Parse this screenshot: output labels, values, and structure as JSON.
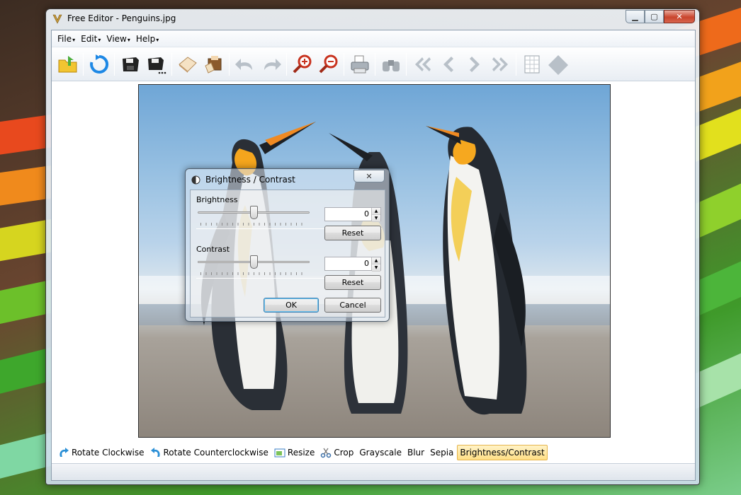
{
  "window": {
    "title": "Free Editor - Penguins.jpg",
    "minimize": "▁",
    "maximize": "▢",
    "close": "✕"
  },
  "menu": [
    {
      "label": "File",
      "arrow": "▾"
    },
    {
      "label": "Edit",
      "arrow": "▾"
    },
    {
      "label": "View",
      "arrow": "▾"
    },
    {
      "label": "Help",
      "arrow": "▾"
    }
  ],
  "toolbar": {
    "icons": [
      "open-folder-icon",
      "refresh-icon",
      "save-icon",
      "save-as-icon",
      "open-image-icon",
      "edit-image-icon",
      "undo-icon",
      "redo-icon",
      "zoom-in-icon",
      "zoom-out-icon",
      "print-icon",
      "binoculars-icon",
      "first-icon",
      "previous-icon",
      "next-icon",
      "last-icon",
      "grid-icon",
      "diamond-icon"
    ]
  },
  "dialog": {
    "title": "Brightness / Contrast",
    "close": "✕",
    "brightness": {
      "label": "Brightness",
      "value": "0",
      "reset": "Reset",
      "level": 0.5
    },
    "contrast": {
      "label": "Contrast",
      "value": "0",
      "reset": "Reset",
      "level": 0.5
    },
    "ok": "OK",
    "cancel": "Cancel"
  },
  "actions": [
    {
      "label": "Rotate Clockwise",
      "icon": "rotate-cw-icon"
    },
    {
      "label": "Rotate Counterclockwise",
      "icon": "rotate-ccw-icon"
    },
    {
      "label": "Resize",
      "icon": "resize-icon"
    },
    {
      "label": "Crop",
      "icon": "crop-icon"
    },
    {
      "label": "Grayscale",
      "icon": ""
    },
    {
      "label": "Blur",
      "icon": ""
    },
    {
      "label": "Sepia",
      "icon": ""
    },
    {
      "label": "Brightness/Contrast",
      "icon": "",
      "active": true
    }
  ],
  "colors": {
    "active_action_bg": "#ffdf85",
    "sky": "#6fa6d6",
    "sand": "#8d857c"
  }
}
